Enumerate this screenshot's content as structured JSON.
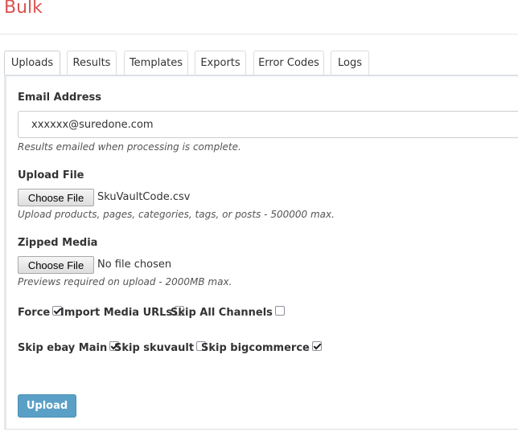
{
  "header": {
    "title": "Bulk"
  },
  "tabs": [
    {
      "label": "Uploads",
      "active": true
    },
    {
      "label": "Results"
    },
    {
      "label": "Templates"
    },
    {
      "label": "Exports"
    },
    {
      "label": "Error Codes"
    },
    {
      "label": "Logs"
    }
  ],
  "form": {
    "email": {
      "label": "Email Address",
      "value": "xxxxxx@suredone.com",
      "help": "Results emailed when processing is complete."
    },
    "upload_file": {
      "label": "Upload File",
      "button": "Choose File",
      "file_name": "SkuVaultCode.csv",
      "help": "Upload products, pages, categories, tags, or posts - 500000 max."
    },
    "zipped_media": {
      "label": "Zipped Media",
      "button": "Choose File",
      "file_name": "No file chosen",
      "help": "Previews required on upload - 2000MB max."
    },
    "options_row1": [
      {
        "label": "Force",
        "checked": true
      },
      {
        "label": "Import Media URLs",
        "checked": false
      },
      {
        "label": "Skip All Channels",
        "checked": false
      }
    ],
    "options_row2": [
      {
        "label": "Skip ebay Main",
        "checked": true
      },
      {
        "label": "Skip skuvault",
        "checked": false
      },
      {
        "label": "Skip bigcommerce",
        "checked": true
      }
    ],
    "submit_label": "Upload"
  },
  "colors": {
    "title": "#d9534f",
    "upload_button": "#5aa0c6"
  }
}
